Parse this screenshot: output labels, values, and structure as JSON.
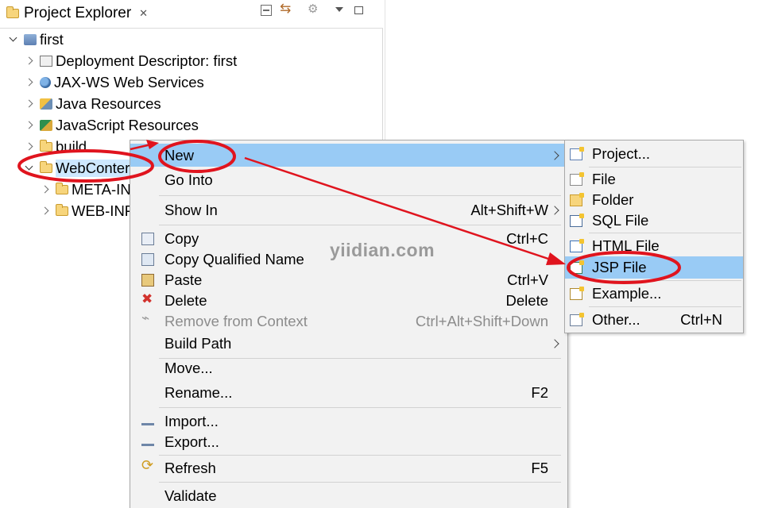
{
  "explorer": {
    "title": "Project Explorer",
    "tree": [
      {
        "label": "first",
        "icon": "project-icon",
        "state": "expanded"
      },
      {
        "label": "Deployment Descriptor: first",
        "icon": "descriptor-icon",
        "state": "collapsed"
      },
      {
        "label": "JAX-WS Web Services",
        "icon": "web-services-icon",
        "state": "collapsed"
      },
      {
        "label": "Java Resources",
        "icon": "java-resources-icon",
        "state": "collapsed"
      },
      {
        "label": "JavaScript Resources",
        "icon": "javascript-resources-icon",
        "state": "collapsed"
      },
      {
        "label": "build",
        "icon": "folder-icon",
        "state": "collapsed"
      },
      {
        "label": "WebConter",
        "icon": "folder-icon",
        "state": "expanded",
        "selected": true
      },
      {
        "label": "META-IN",
        "icon": "folder-icon",
        "state": "collapsed"
      },
      {
        "label": "WEB-INF",
        "icon": "folder-icon",
        "state": "collapsed"
      }
    ]
  },
  "context_menu": {
    "items": [
      {
        "label": "New",
        "submenu": true,
        "highlighted": true
      },
      {
        "label": "Go Into"
      },
      {
        "label": "Show In",
        "accel": "Alt+Shift+W",
        "submenu": true
      },
      {
        "label": "Copy",
        "accel": "Ctrl+C",
        "icon": "copy-icon"
      },
      {
        "label": "Copy Qualified Name",
        "icon": "copy-qualified-name-icon"
      },
      {
        "label": "Paste",
        "accel": "Ctrl+V",
        "icon": "paste-icon"
      },
      {
        "label": "Delete",
        "accel": "Delete",
        "icon": "delete-icon"
      },
      {
        "label": "Remove from Context",
        "accel": "Ctrl+Alt+Shift+Down",
        "icon": "remove-context-icon",
        "disabled": true
      },
      {
        "label": "Build Path",
        "submenu": true
      },
      {
        "label": "Move..."
      },
      {
        "label": "Rename...",
        "accel": "F2"
      },
      {
        "label": "Import...",
        "icon": "import-icon"
      },
      {
        "label": "Export...",
        "icon": "export-icon"
      },
      {
        "label": "Refresh",
        "accel": "F5",
        "icon": "refresh-icon"
      },
      {
        "label": "Validate"
      }
    ]
  },
  "submenu_new": {
    "items": [
      {
        "label": "Project...",
        "icon": "new-project-icon"
      },
      {
        "label": "File",
        "icon": "new-file-icon"
      },
      {
        "label": "Folder",
        "icon": "new-folder-icon"
      },
      {
        "label": "SQL File",
        "icon": "sql-file-icon"
      },
      {
        "label": "HTML File",
        "icon": "html-file-icon"
      },
      {
        "label": "JSP File",
        "icon": "jsp-file-icon",
        "highlighted": true
      },
      {
        "label": "Example...",
        "icon": "example-icon"
      },
      {
        "label": "Other...",
        "accel": "Ctrl+N",
        "icon": "other-wizard-icon"
      }
    ]
  },
  "watermark": "yiidian.com",
  "colors": {
    "menu_bg": "#f2f2f2",
    "highlight": "#99cbf5",
    "annotation_red": "#e0141e",
    "selection": "#cde8ff"
  }
}
